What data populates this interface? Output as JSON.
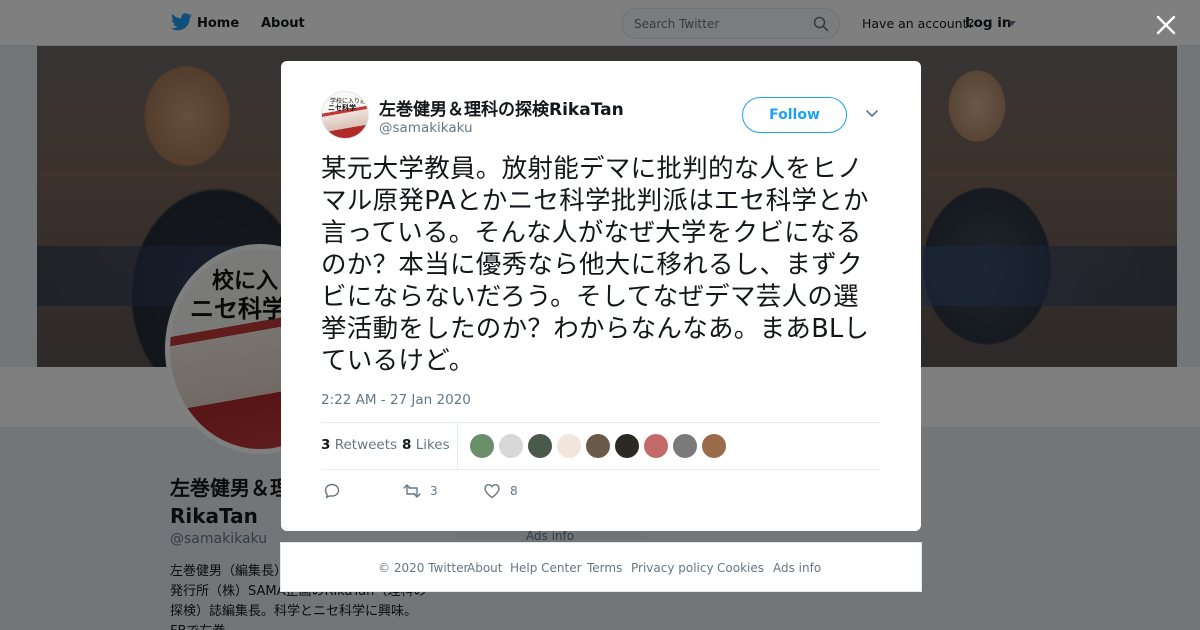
{
  "nav": {
    "home_label": "Home",
    "about_label": "About",
    "search_placeholder": "Search Twitter",
    "have_account": "Have an account?",
    "login_label": "Log in"
  },
  "profile": {
    "name_line1": "左巻健男＆理",
    "name_line2": "RikaTan",
    "handle": "@samakikaku",
    "bio": "左巻健男（編集長）（非）・元法政大学教授。発行所（株）SAMA企画のRikaTan（理科の探検）誌編集長。科学とニセ科学に興味。FBで左巻",
    "avatar_text1": "校に入り",
    "avatar_text2": "ニセ科学",
    "ads_info": "Ads info"
  },
  "tweet": {
    "author_name": "左巻健男＆理科の探検RikaTan",
    "author_handle": "@samakikaku",
    "avatar_text1": "学校に入り込む",
    "avatar_text2": "ニセ科学",
    "follow_label": "Follow",
    "text": "某元大学教員。放射能デマに批判的な人をヒノマル原発PAとかニセ科学批判派はエセ科学とか言っている。そんな人がなぜ大学をクビになるのか？本当に優秀なら他大に移れるし、まずクビにならないだろう。そしてなぜデマ芸人の選挙活動をしたのか？わからなんなあ。まあBLしているけど。",
    "timestamp": "2:22 AM - 27 Jan 2020",
    "retweets_count": "3",
    "retweets_label": "Retweets",
    "likes_count": "8",
    "likes_label": "Likes",
    "retweet_action_count": "3",
    "like_action_count": "8"
  },
  "likers": [
    {
      "color": "#6b8f6b"
    },
    {
      "color": "#d8d8d8"
    },
    {
      "color": "#4a5a4a"
    },
    {
      "color": "#f2e6dc"
    },
    {
      "color": "#6a5a4a"
    },
    {
      "color": "#2a2a22"
    },
    {
      "color": "#c46a6a"
    },
    {
      "color": "#7a7a7a"
    },
    {
      "color": "#9a6a4a"
    }
  ],
  "footer": {
    "copyright": "© 2020 Twitter",
    "about": "About",
    "help": "Help Center",
    "terms": "Terms",
    "privacy": "Privacy policy",
    "cookies": "Cookies",
    "ads": "Ads info"
  },
  "colors": {
    "twitter_blue": "#1da1f2",
    "text_primary": "#14171a",
    "text_secondary": "#657786"
  }
}
